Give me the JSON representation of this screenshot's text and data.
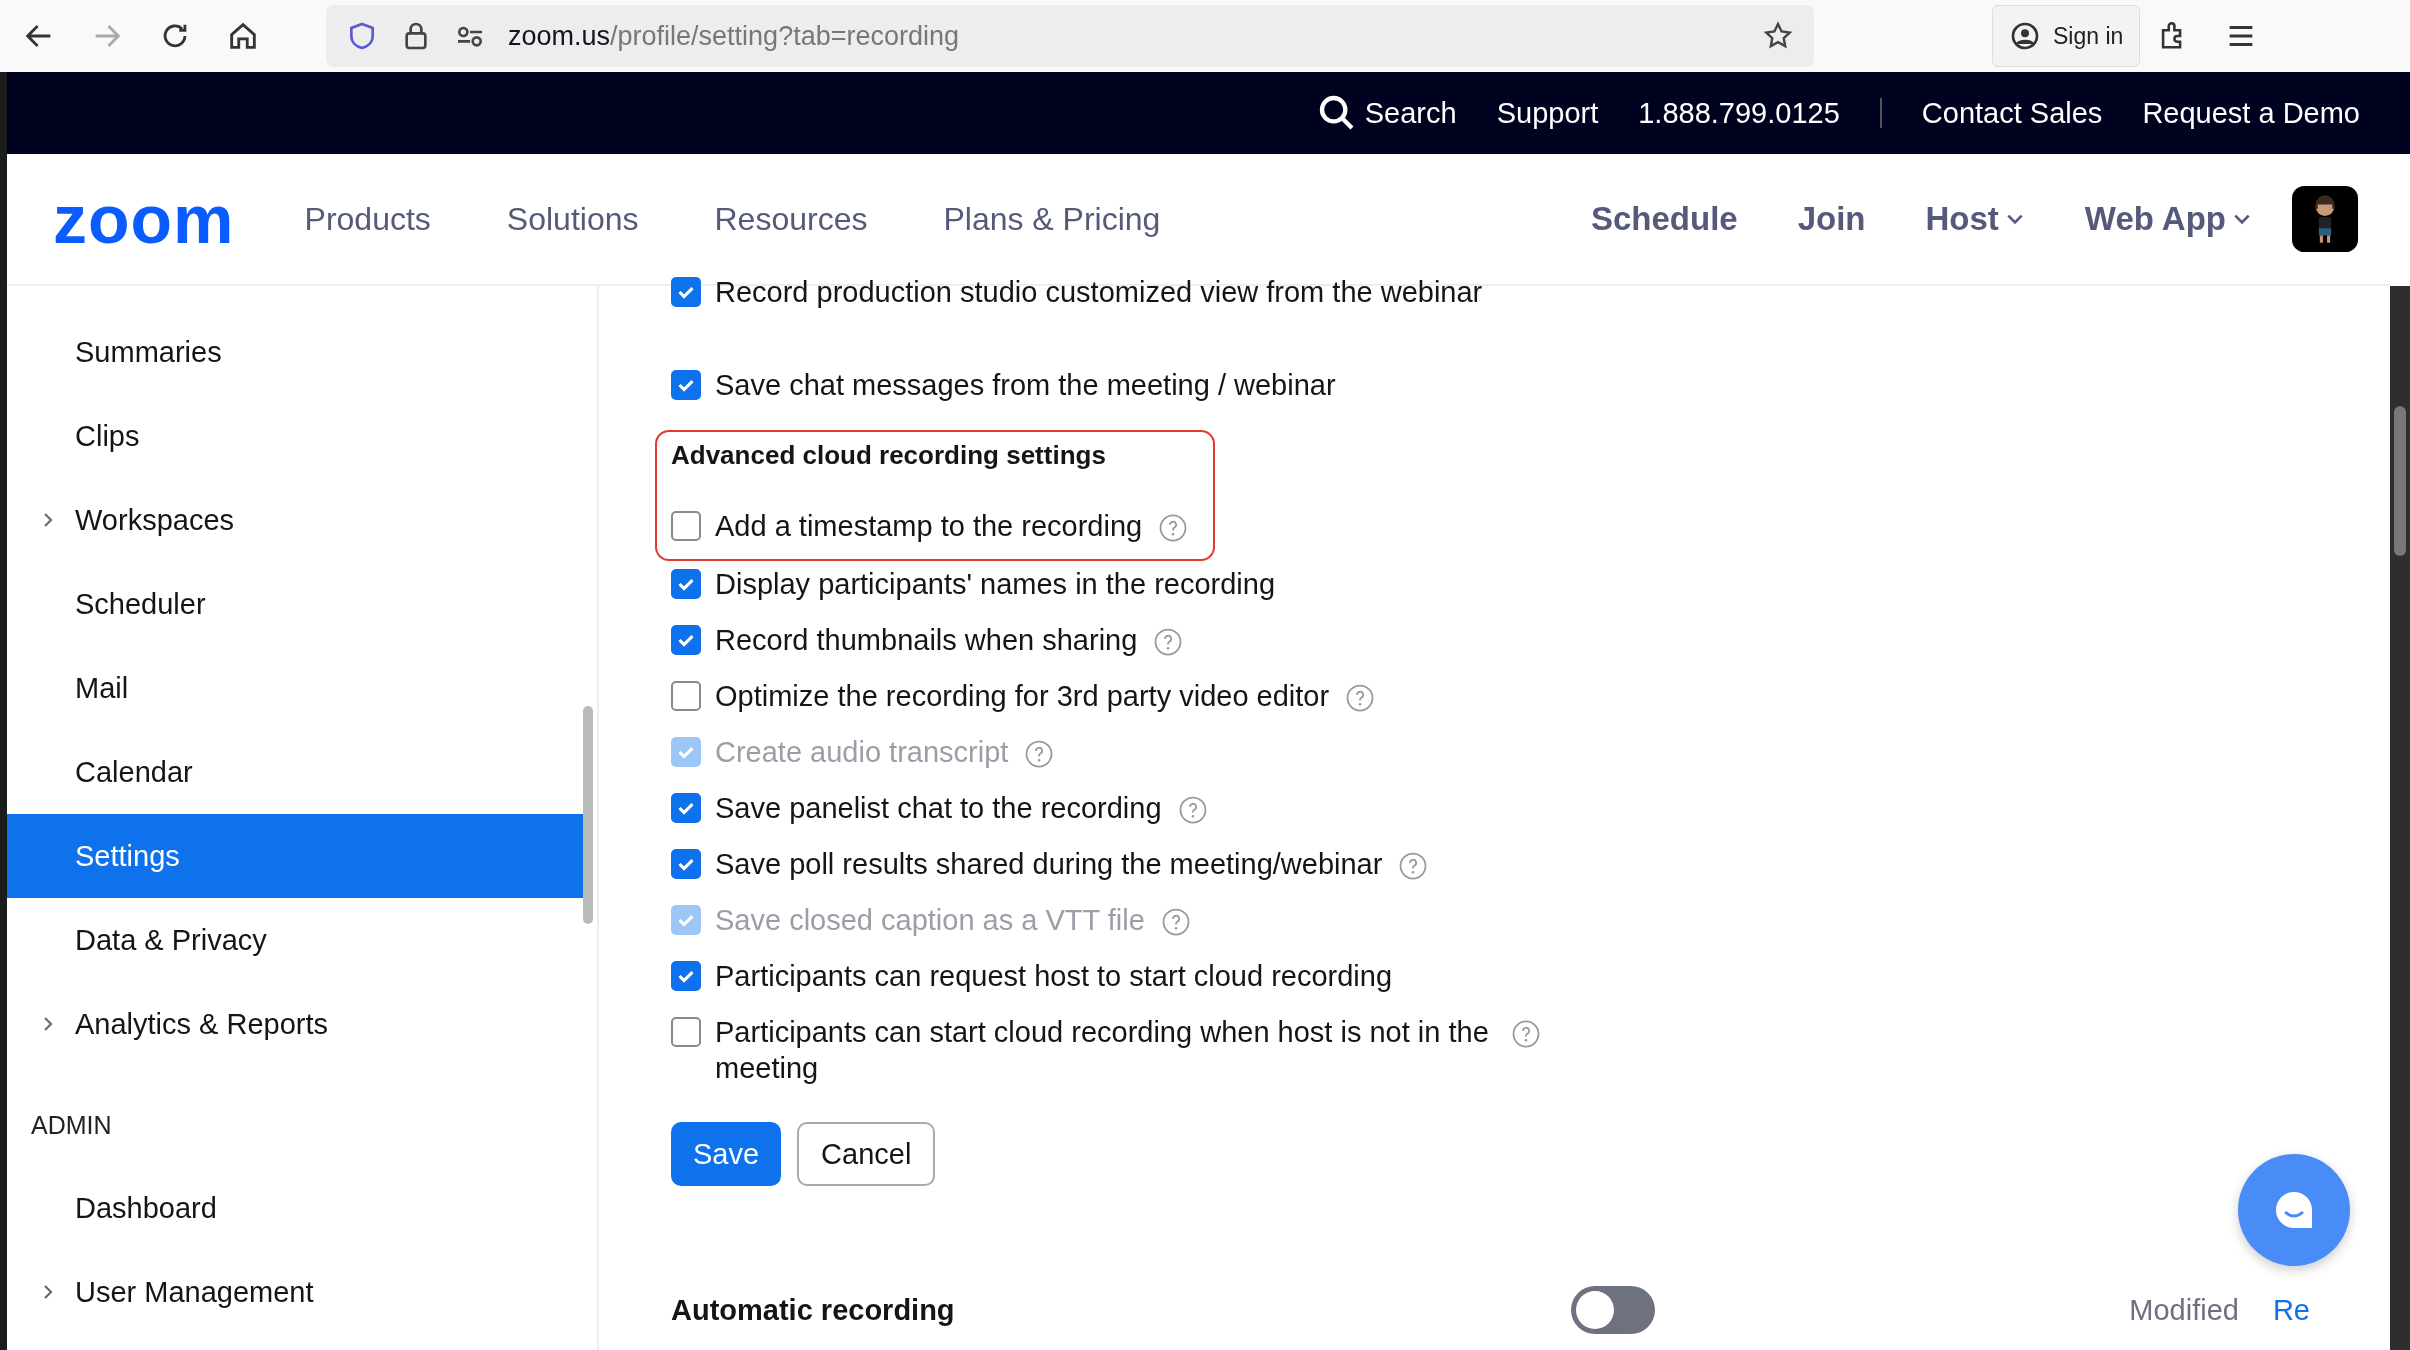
{
  "browser": {
    "url_host": "zoom.us",
    "url_path": "/profile/setting?tab=recording",
    "sign_in": "Sign in",
    "forward_disabled": true
  },
  "top_bar": {
    "links": [
      {
        "label": "Search",
        "kind": "search"
      },
      {
        "label": "Support",
        "kind": "link"
      },
      {
        "label": "1.888.799.0125",
        "kind": "link"
      },
      {
        "label": "Contact Sales",
        "kind": "link"
      },
      {
        "label": "Request a Demo",
        "kind": "link"
      }
    ]
  },
  "header": {
    "logo": "zoom",
    "nav": [
      "Products",
      "Solutions",
      "Resources",
      "Plans & Pricing"
    ],
    "right": [
      {
        "label": "Schedule",
        "dropdown": false
      },
      {
        "label": "Join",
        "dropdown": false
      },
      {
        "label": "Host",
        "dropdown": true
      },
      {
        "label": "Web App",
        "dropdown": true
      }
    ]
  },
  "sidebar": {
    "items": [
      {
        "label": "Summaries",
        "kind": "item",
        "expandable": false,
        "selected": false
      },
      {
        "label": "Clips",
        "kind": "item",
        "expandable": false,
        "selected": false
      },
      {
        "label": "Workspaces",
        "kind": "item",
        "expandable": true,
        "selected": false
      },
      {
        "label": "Scheduler",
        "kind": "item",
        "expandable": false,
        "selected": false
      },
      {
        "label": "Mail",
        "kind": "item",
        "expandable": false,
        "selected": false
      },
      {
        "label": "Calendar",
        "kind": "item",
        "expandable": false,
        "selected": false
      },
      {
        "label": "Settings",
        "kind": "item",
        "expandable": false,
        "selected": true
      },
      {
        "label": "Data & Privacy",
        "kind": "item",
        "expandable": false,
        "selected": false
      },
      {
        "label": "Analytics & Reports",
        "kind": "item",
        "expandable": true,
        "selected": false
      },
      {
        "label": "ADMIN",
        "kind": "section"
      },
      {
        "label": "Dashboard",
        "kind": "item",
        "expandable": false,
        "selected": false
      },
      {
        "label": "User Management",
        "kind": "item",
        "expandable": true,
        "selected": false
      }
    ]
  },
  "options_before": [
    {
      "label": "Record production studio customized view from the webinar",
      "checked": true,
      "disabled": false,
      "help": false
    },
    {
      "label": "Save chat messages from the meeting / webinar",
      "checked": true,
      "disabled": false,
      "help": false
    }
  ],
  "highlight": {
    "heading": "Advanced cloud recording settings",
    "option": {
      "label": "Add a timestamp to the recording",
      "checked": false,
      "disabled": false,
      "help": true
    }
  },
  "options": [
    {
      "label": "Display participants' names in the recording",
      "checked": true,
      "disabled": false,
      "help": false
    },
    {
      "label": "Record thumbnails when sharing",
      "checked": true,
      "disabled": false,
      "help": true
    },
    {
      "label": "Optimize the recording for 3rd party video editor",
      "checked": false,
      "disabled": false,
      "help": true
    },
    {
      "label": "Create audio transcript",
      "checked": true,
      "disabled": true,
      "help": true
    },
    {
      "label": "Save panelist chat to the recording",
      "checked": true,
      "disabled": false,
      "help": true
    },
    {
      "label": "Save poll results shared during the meeting/webinar",
      "checked": true,
      "disabled": false,
      "help": true
    },
    {
      "label": "Save closed caption as a VTT file",
      "checked": true,
      "disabled": true,
      "help": true
    },
    {
      "label": "Participants can request host to start cloud recording",
      "checked": true,
      "disabled": false,
      "help": false
    },
    {
      "label": "Participants can start cloud recording when host is not in the meeting",
      "checked": false,
      "disabled": false,
      "help": true
    }
  ],
  "buttons": [
    {
      "label": "Save",
      "kind": "primary"
    },
    {
      "label": "Cancel",
      "kind": "secondary"
    }
  ],
  "automatic_recording": {
    "label": "Automatic recording",
    "on": false,
    "status": "Modified",
    "reset": "Re"
  }
}
